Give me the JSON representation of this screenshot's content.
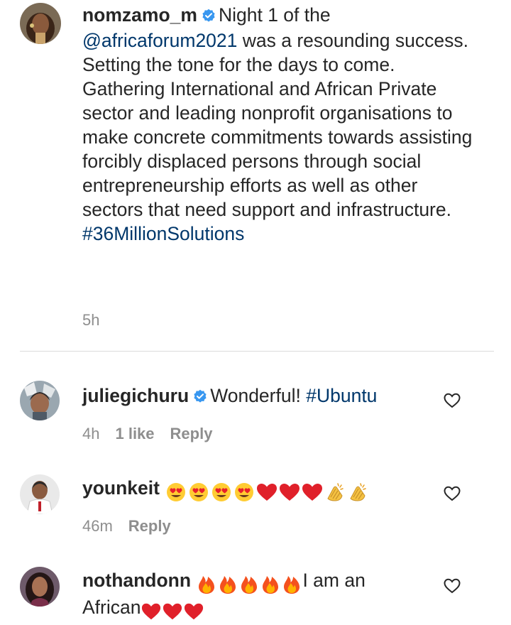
{
  "post": {
    "username": "nomzamo_m",
    "caption_lines": [
      "Night 1 of the",
      "@africaforum2021",
      " was a resounding success. Setting the tone for the days to come. Gathering International and African Private sector and leading nonprofit organisations to make concrete commitments towards assisting forcibly displaced persons through social entrepreneurship efforts as well as other sectors that need support and infrastructure.",
      "#36MillionSolutions"
    ],
    "time": "5h"
  },
  "comments": [
    {
      "username": "juliegichuru",
      "text": "Wonderful!",
      "hashtag": "#Ubuntu",
      "time": "4h",
      "likes": "1 like",
      "reply": "Reply"
    },
    {
      "username": "younkeit",
      "emojis": [
        "heart-eyes",
        "heart-eyes",
        "heart-eyes",
        "heart-eyes",
        "red-heart",
        "red-heart",
        "red-heart",
        "clapping-hands",
        "clapping-hands"
      ],
      "time": "46m",
      "reply": "Reply"
    },
    {
      "username": "nothandonn",
      "text_after_fire": "I am an",
      "text_line2": "African",
      "emojis_fire": [
        "fire",
        "fire",
        "fire",
        "fire",
        "fire"
      ],
      "emojis_hearts": [
        "red-heart",
        "red-heart",
        "red-heart"
      ]
    }
  ],
  "colors": {
    "text": "#262626",
    "secondary": "#8e8e8e",
    "link": "#00376b",
    "verified": "#3897f0",
    "divider": "#dbdbdb"
  },
  "icons": {
    "verified": "verified-badge-icon",
    "like": "heart-outline-icon"
  }
}
